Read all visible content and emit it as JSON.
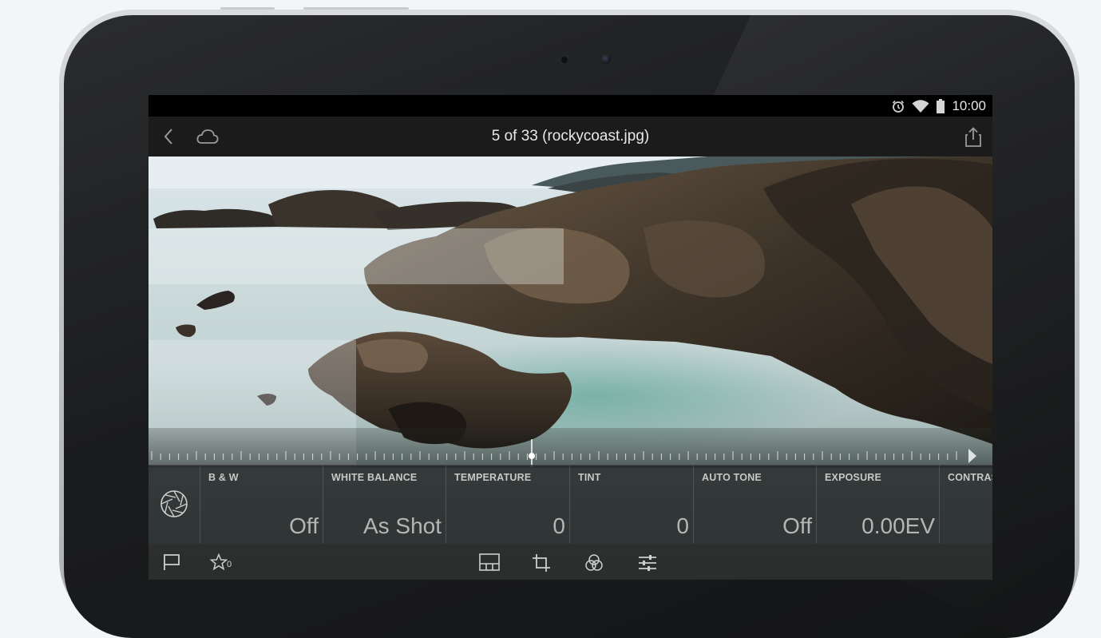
{
  "status_bar": {
    "time": "10:00",
    "icons": [
      "alarm-icon",
      "wifi-icon",
      "battery-icon"
    ]
  },
  "title_bar": {
    "title": "5 of 33 (rockycoast.jpg)",
    "icons": [
      "back-icon",
      "cloud-icon",
      "share-icon"
    ]
  },
  "adjustments": [
    {
      "label": "B & W",
      "value": "Off"
    },
    {
      "label": "WHITE BALANCE",
      "value": "As Shot"
    },
    {
      "label": "TEMPERATURE",
      "value": "0"
    },
    {
      "label": "TINT",
      "value": "0"
    },
    {
      "label": "AUTO TONE",
      "value": "Off"
    },
    {
      "label": "EXPOSURE",
      "value": "0.00EV"
    },
    {
      "label": "CONTRAS",
      "value": ""
    }
  ],
  "bottom_bar": {
    "star_count": "0",
    "icons": [
      "flag-icon",
      "star-icon",
      "filmstrip-icon",
      "crop-icon",
      "presets-icon",
      "adjustments-icon"
    ]
  },
  "colors": {
    "screen_bg": "#000000",
    "title_bar_bg": "#1b1b1b",
    "panel_bg": "#202122",
    "text_primary": "#e8e8e8",
    "text_secondary": "#b6b6b6"
  }
}
